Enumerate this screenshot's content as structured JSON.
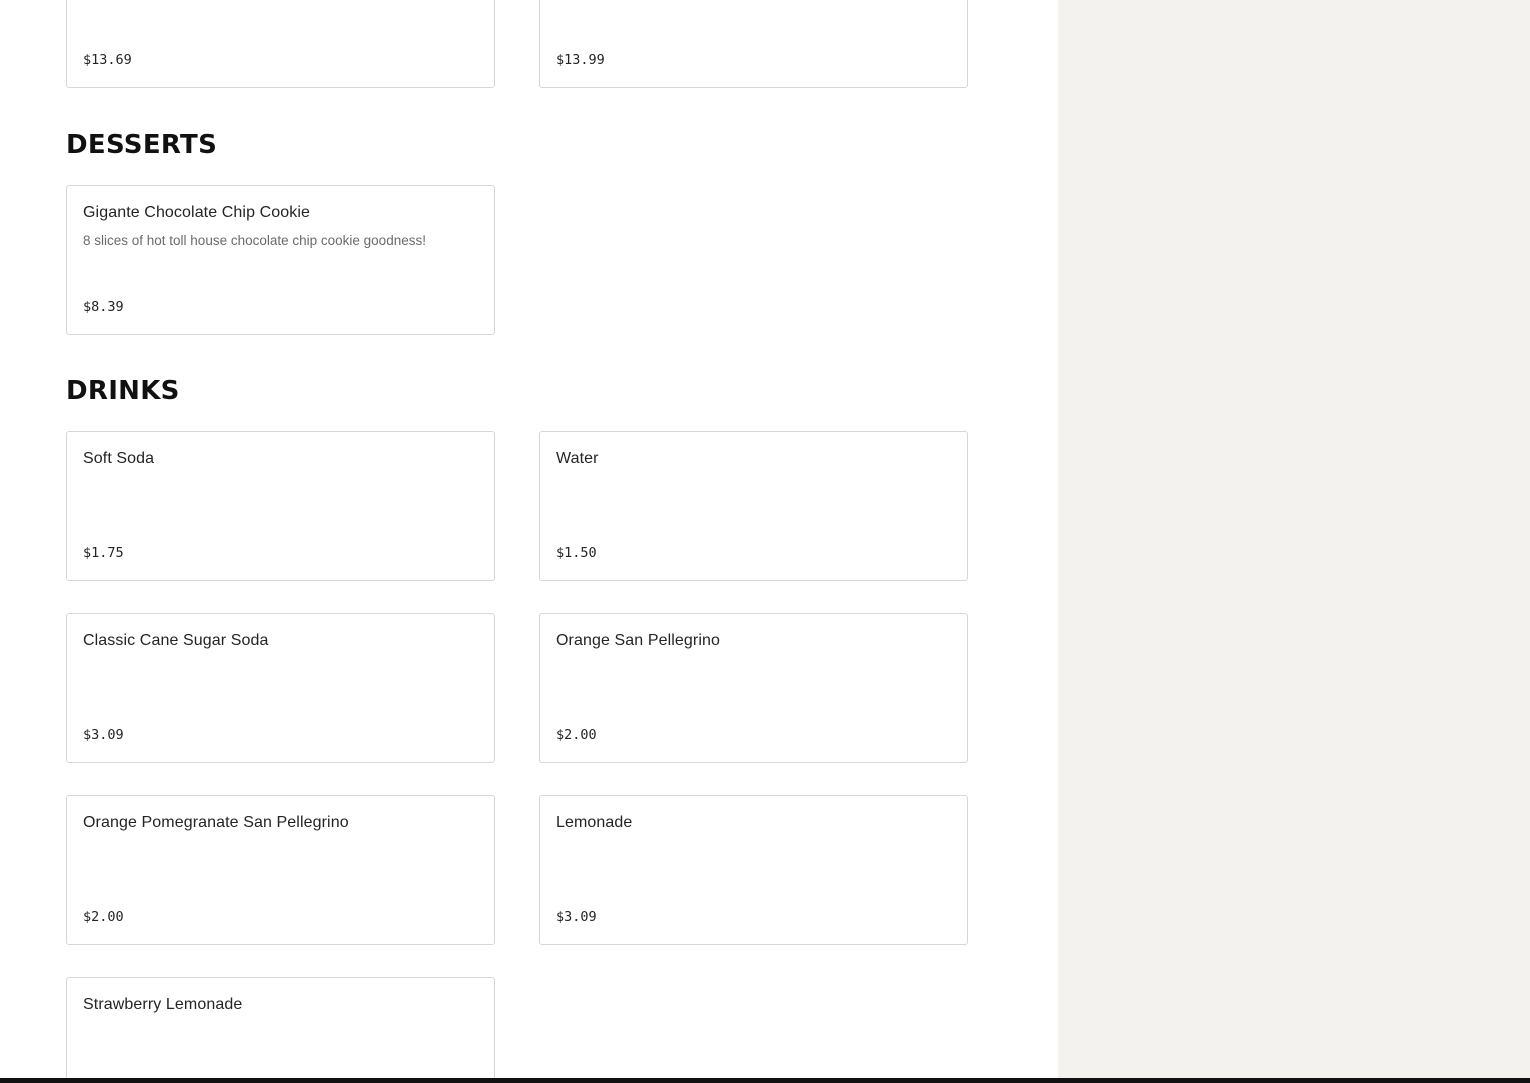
{
  "top_items": [
    {
      "price": "$13.69"
    },
    {
      "price": "$13.99"
    }
  ],
  "desserts": {
    "title": "DESSERTS",
    "items": [
      {
        "name": "Gigante Chocolate Chip Cookie",
        "description": "8 slices of hot toll house chocolate chip cookie goodness!",
        "price": "$8.39"
      }
    ]
  },
  "drinks": {
    "title": "DRINKS",
    "items": [
      {
        "name": "Soft Soda",
        "price": "$1.75"
      },
      {
        "name": "Water",
        "price": "$1.50"
      },
      {
        "name": "Classic Cane Sugar Soda",
        "price": "$3.09"
      },
      {
        "name": "Orange San Pellegrino",
        "price": "$2.00"
      },
      {
        "name": "Orange Pomegranate San Pellegrino",
        "price": "$2.00"
      },
      {
        "name": "Lemonade",
        "price": "$3.09"
      },
      {
        "name": "Strawberry Lemonade"
      }
    ]
  },
  "colors": {
    "side_panel_bg": "#f3f2ef",
    "card_border": "#d6d6d6",
    "bottom_bar": "#111111"
  }
}
